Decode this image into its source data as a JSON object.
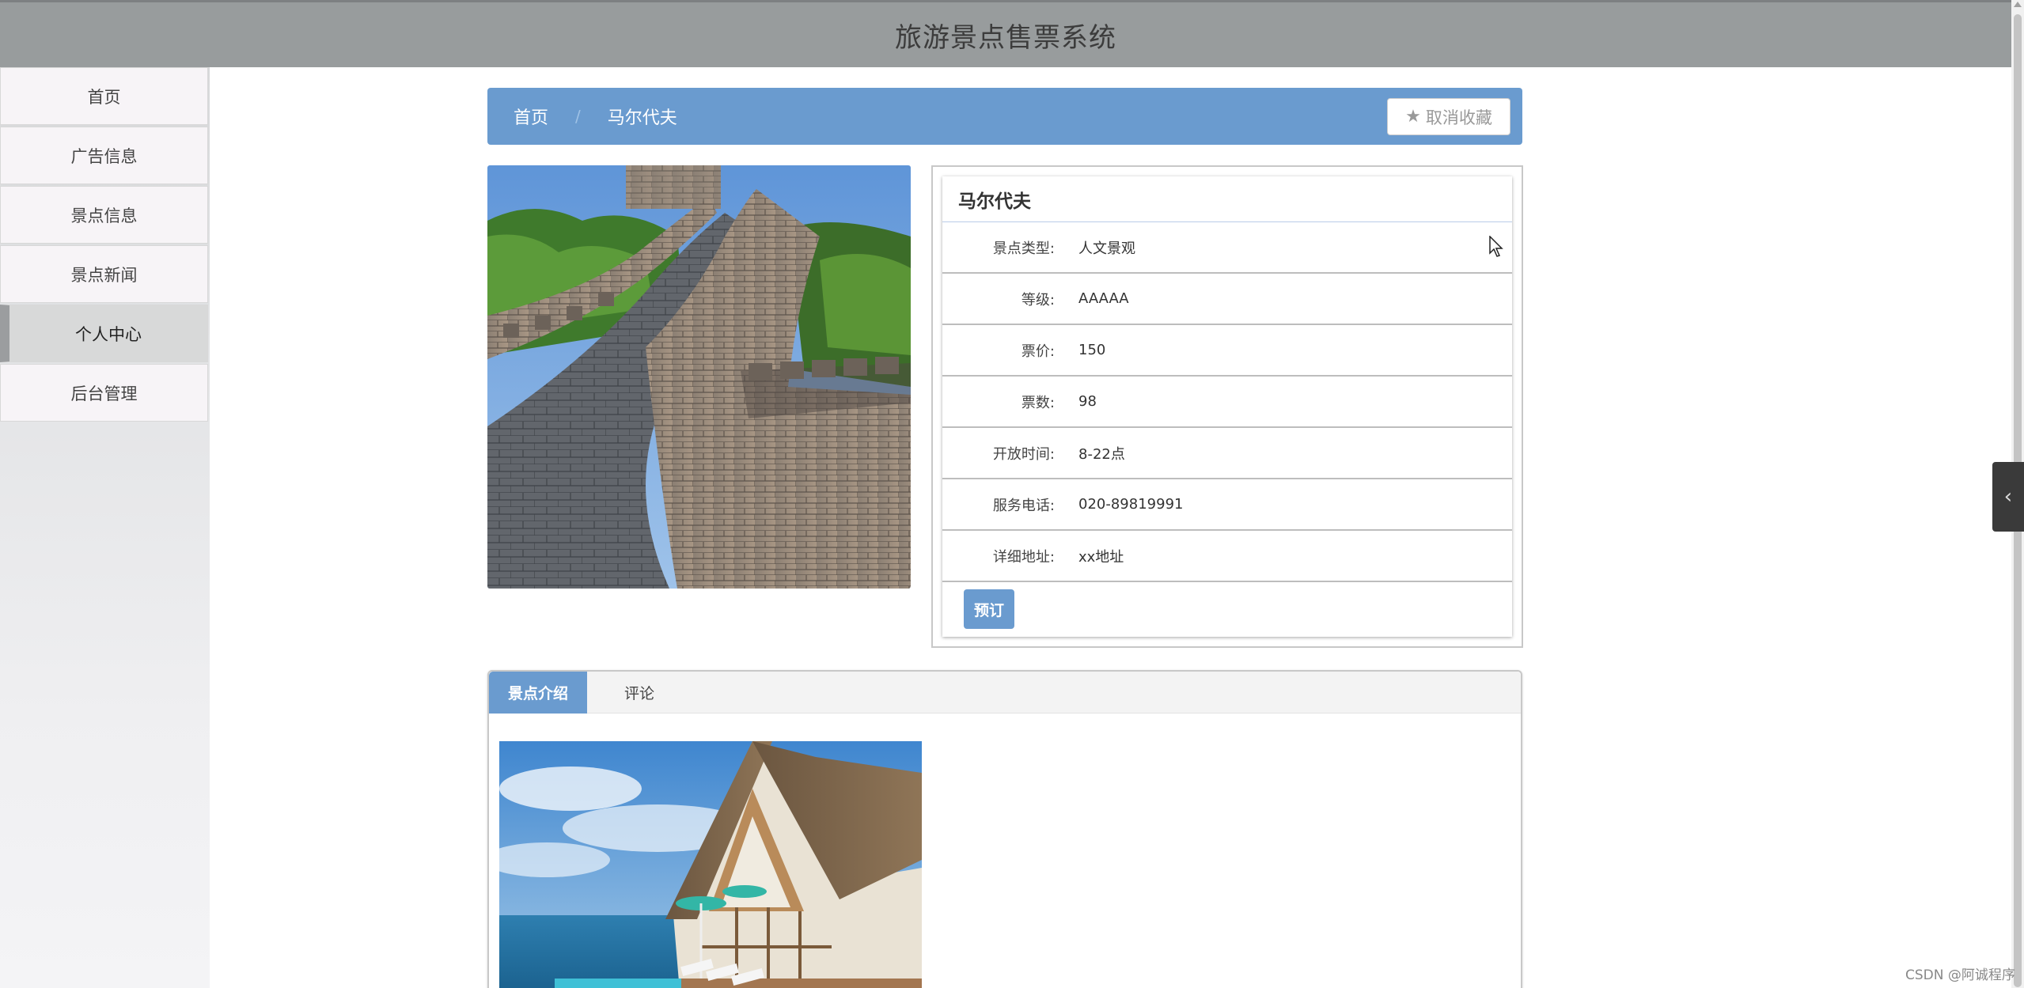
{
  "header": {
    "title": "旅游景点售票系统"
  },
  "sidebar": {
    "items": [
      {
        "label": "首页"
      },
      {
        "label": "广告信息"
      },
      {
        "label": "景点信息"
      },
      {
        "label": "景点新闻"
      },
      {
        "label": "个人中心",
        "active": true
      },
      {
        "label": "后台管理"
      }
    ]
  },
  "breadcrumb": {
    "home": "首页",
    "separator": "/",
    "current": "马尔代夫"
  },
  "favorite": {
    "icon": "star-icon",
    "label": "取消收藏"
  },
  "detail": {
    "name": "马尔代夫",
    "fields": [
      {
        "label": "景点类型:",
        "value": "人文景观"
      },
      {
        "label": "等级:",
        "value": "AAAAA"
      },
      {
        "label": "票价:",
        "value": "150"
      },
      {
        "label": "票数:",
        "value": "98"
      },
      {
        "label": "开放时间:",
        "value": "8-22点"
      },
      {
        "label": "服务电话:",
        "value": "020-89819991"
      },
      {
        "label": "详细地址:",
        "value": "xx地址"
      }
    ],
    "book_label": "预订"
  },
  "tabs": [
    {
      "label": "景点介绍",
      "active": true
    },
    {
      "label": "评论"
    }
  ],
  "watermark": "CSDN @阿诚程序",
  "colors": {
    "header_bg": "#989c9d",
    "accent_blue": "#6a9bcf",
    "sidebar_active": "#d8d9d9"
  }
}
